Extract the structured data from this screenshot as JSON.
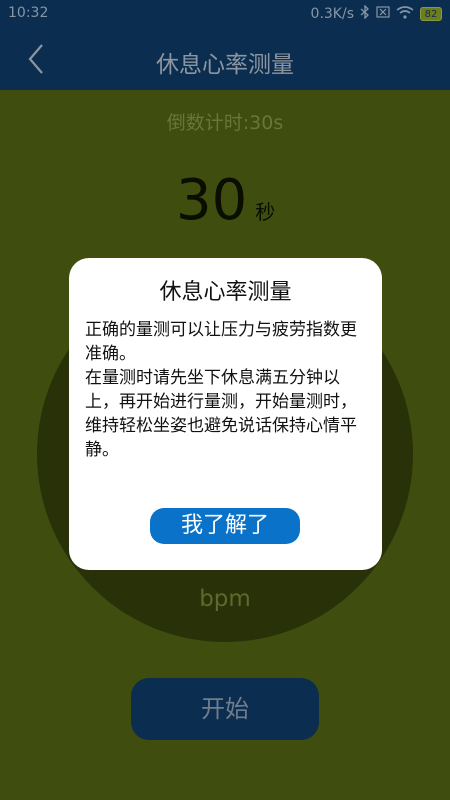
{
  "status_bar": {
    "time": "10:32",
    "net_speed": "0.3K/s",
    "battery": "82"
  },
  "header": {
    "title": "休息心率测量"
  },
  "main": {
    "countdown_label": "倒数计时:30s",
    "seconds_value": "30",
    "seconds_unit": "秒",
    "bpm_label": "bpm",
    "start_button": "开始"
  },
  "dialog": {
    "title": "休息心率测量",
    "paragraph1": "正确的量测可以让压力与疲劳指数更准确。",
    "paragraph2": "在量测时请先坐下休息满五分钟以上，再开始进行量测，开始量测时，维持轻松坐姿也避免说话保持心情平静。",
    "confirm_button": "我了解了"
  },
  "colors": {
    "header_bg": "#0b2d4f",
    "page_bg": "#3f4d0f",
    "confirm_button": "#0a73c9"
  }
}
